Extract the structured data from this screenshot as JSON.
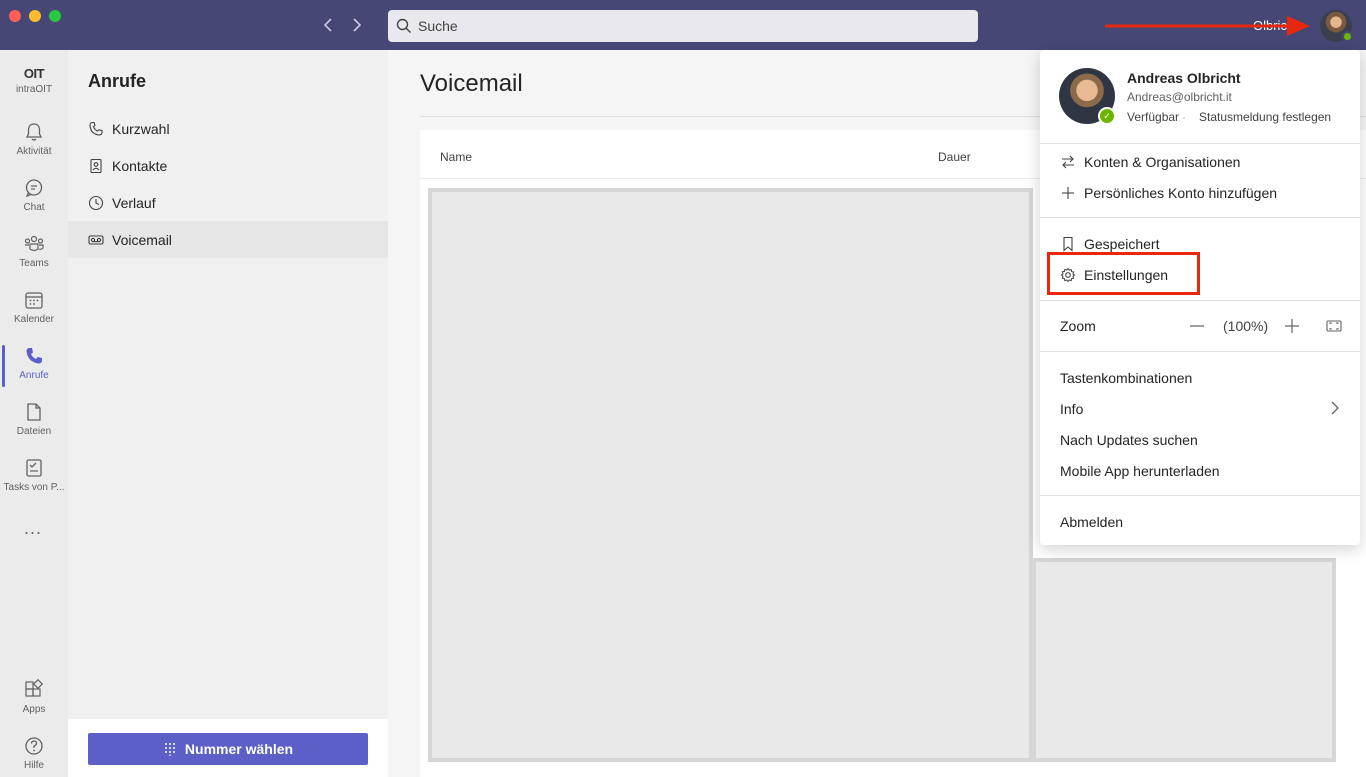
{
  "titlebar": {
    "search_placeholder": "Suche",
    "user_short": "Olbricht",
    "accent": "#464775"
  },
  "rail": {
    "items": [
      {
        "label": "intraOIT",
        "icon": "org-logo-icon"
      },
      {
        "label": "Aktivität",
        "icon": "bell-icon"
      },
      {
        "label": "Chat",
        "icon": "chat-icon"
      },
      {
        "label": "Teams",
        "icon": "teams-icon"
      },
      {
        "label": "Kalender",
        "icon": "calendar-icon"
      },
      {
        "label": "Anrufe",
        "icon": "phone-icon"
      },
      {
        "label": "Dateien",
        "icon": "file-icon"
      },
      {
        "label": "Tasks von P...",
        "icon": "tasks-icon"
      }
    ],
    "more": "...",
    "bottom": [
      {
        "label": "Apps",
        "icon": "apps-icon"
      },
      {
        "label": "Hilfe",
        "icon": "help-icon"
      }
    ]
  },
  "leftpane": {
    "title": "Anrufe",
    "items": [
      {
        "label": "Kurzwahl",
        "icon": "phone-icon"
      },
      {
        "label": "Kontakte",
        "icon": "contact-card-icon"
      },
      {
        "label": "Verlauf",
        "icon": "clock-icon"
      },
      {
        "label": "Voicemail",
        "icon": "voicemail-icon"
      }
    ],
    "active": "Voicemail",
    "dial_button": "Nummer wählen"
  },
  "main": {
    "title": "Voicemail",
    "columns": [
      "Name",
      "Dauer"
    ]
  },
  "profile_menu": {
    "name": "Andreas Olbricht",
    "email": "Andreas@olbricht.it",
    "availability": "Verfügbar",
    "separator": "·",
    "status_message": "Statusmeldung festlegen",
    "accounts": "Konten & Organisationen",
    "add_account": "Persönliches Konto hinzufügen",
    "saved": "Gespeichert",
    "settings": "Einstellungen",
    "zoom_label": "Zoom",
    "zoom_value": "(100%)",
    "shortcuts": "Tastenkombinationen",
    "info": "Info",
    "check_updates": "Nach Updates suchen",
    "mobile_app": "Mobile App herunterladen",
    "sign_out": "Abmelden"
  },
  "colors": {
    "brand": "#5b5fc7",
    "status_available": "#6bb700",
    "highlight": "#e8280d"
  }
}
